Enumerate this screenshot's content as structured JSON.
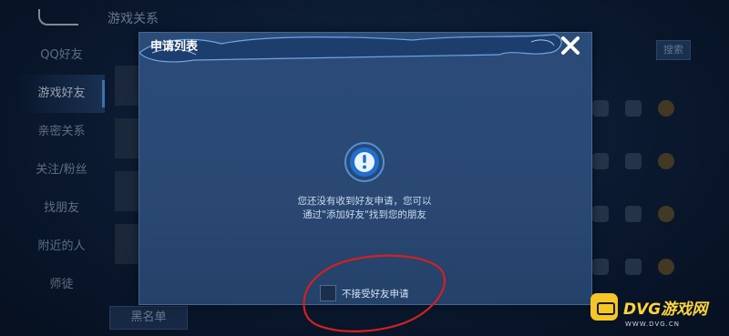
{
  "background": {
    "title": "游戏关系",
    "sidebar": [
      {
        "label": "QQ好友",
        "active": false
      },
      {
        "label": "游戏好友",
        "active": true
      },
      {
        "label": "亲密关系",
        "active": false
      },
      {
        "label": "关注/粉丝",
        "active": false
      },
      {
        "label": "找朋友",
        "active": false
      },
      {
        "label": "附近的人",
        "active": false
      },
      {
        "label": "师徒",
        "active": false
      }
    ],
    "blacklist_label": "黑名单",
    "search_label": "搜索"
  },
  "modal": {
    "title": "申请列表",
    "message_line1": "您还没有收到好友申请，您可以",
    "message_line2": "通过\"添加好友\"找到您的朋友",
    "checkbox_label": "不接受好友申请",
    "checkbox_checked": false
  },
  "annotation": {
    "color": "#d42020"
  },
  "watermark": {
    "main": "DVG游戏网",
    "sub": "WWW.DVG.CN",
    "color": "#ffd43a"
  }
}
